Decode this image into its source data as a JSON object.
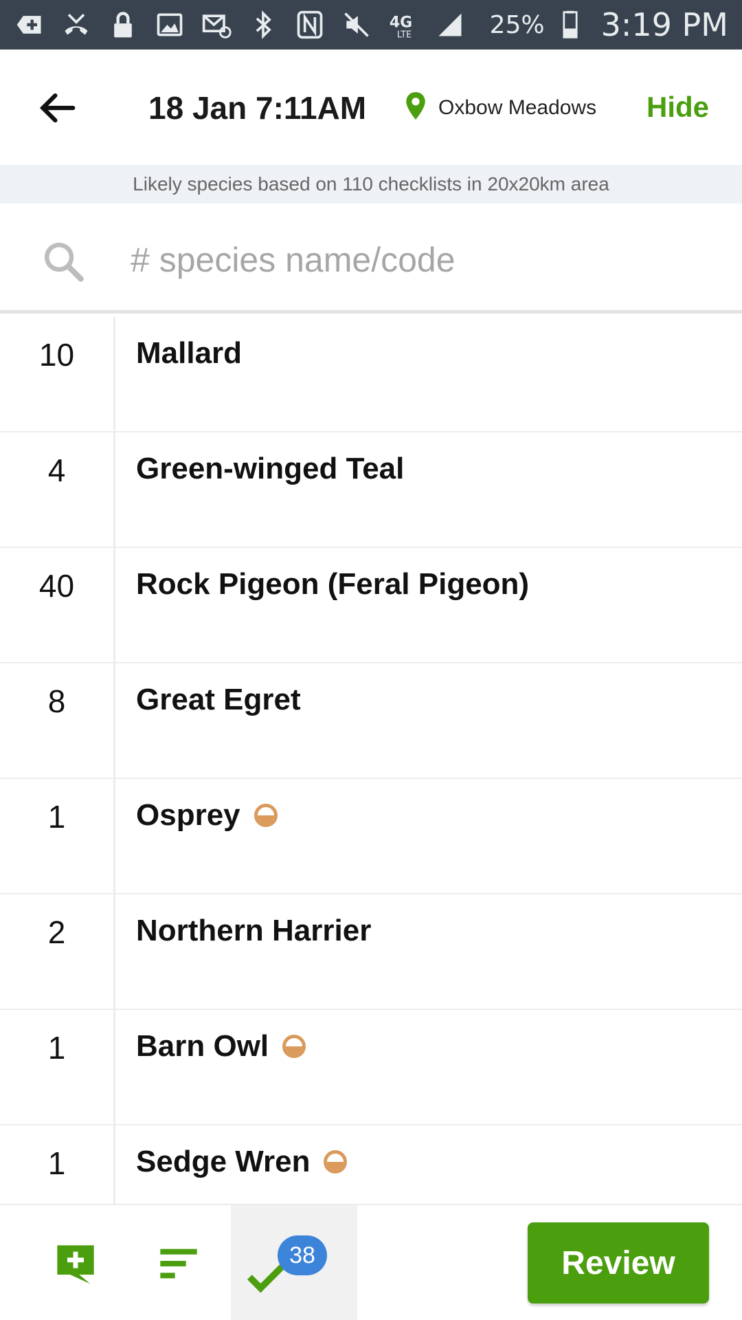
{
  "status_bar": {
    "battery_percent": "25%",
    "time": "3:19 PM",
    "network": "4G LTE",
    "icons": [
      "add-notification-icon",
      "missed-call-icon",
      "lock-icon",
      "image-icon",
      "email-icon",
      "bluetooth-icon",
      "nfc-icon",
      "mute-icon",
      "lte-icon",
      "signal-icon",
      "battery-icon"
    ]
  },
  "header": {
    "date_time": "18 Jan 7:11AM",
    "location": "Oxbow Meadows",
    "hide_label": "Hide"
  },
  "info_banner": "Likely species based on 110 checklists in 20x20km area",
  "search": {
    "placeholder": "# species name/code",
    "value": ""
  },
  "species": [
    {
      "count": "10",
      "name": "Mallard",
      "rare": false
    },
    {
      "count": "4",
      "name": "Green-winged Teal",
      "rare": false
    },
    {
      "count": "40",
      "name": "Rock Pigeon (Feral Pigeon)",
      "rare": false
    },
    {
      "count": "8",
      "name": "Great Egret",
      "rare": false
    },
    {
      "count": "1",
      "name": "Osprey",
      "rare": true
    },
    {
      "count": "2",
      "name": "Northern Harrier",
      "rare": false
    },
    {
      "count": "1",
      "name": "Barn Owl",
      "rare": true
    },
    {
      "count": "1",
      "name": "Sedge Wren",
      "rare": true
    }
  ],
  "bottom_bar": {
    "badge_count": "38",
    "review_label": "Review"
  },
  "colors": {
    "accent_green": "#4b9e0e",
    "badge_blue": "#3c84d9",
    "rare_orange": "#d99a5b",
    "status_bar_bg": "#38434f"
  }
}
